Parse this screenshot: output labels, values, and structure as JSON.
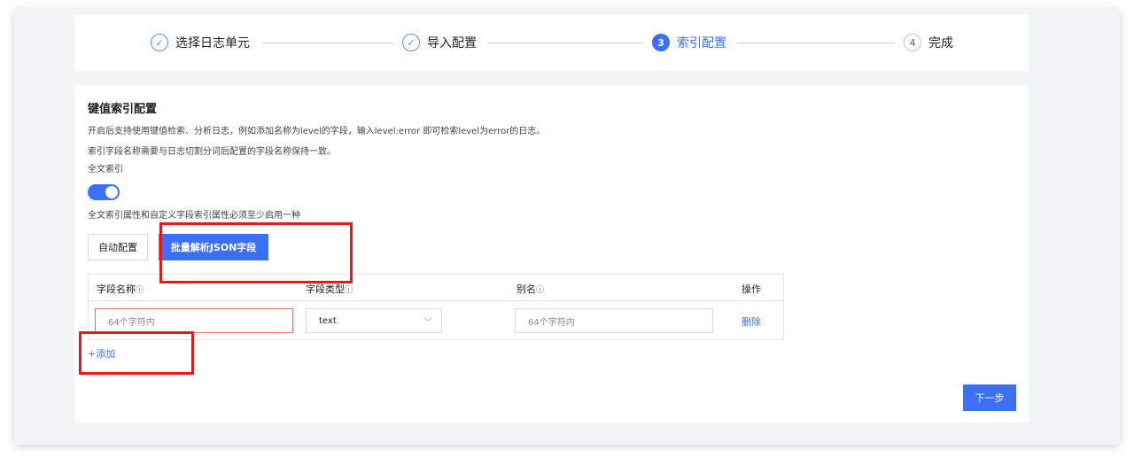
{
  "steps": [
    {
      "label": "选择日志单元",
      "marker": "✓",
      "state": "done"
    },
    {
      "label": "导入配置",
      "marker": "✓",
      "state": "done"
    },
    {
      "label": "索引配置",
      "marker": "3",
      "state": "active"
    },
    {
      "label": "完成",
      "marker": "4",
      "state": "pending"
    }
  ],
  "section": {
    "title": "键值索引配置",
    "desc1": "开启后支持使用键值检索、分析日志，例如添加名称为level的字段，输入level:error 即可检索level为error的日志。",
    "desc2": "索引字段名称需要与日志切割分词后配置的字段名称保持一致。",
    "fulltext_label": "全文索引",
    "fulltext_enabled": true,
    "fulltext_hint": "全文索引属性和自定义字段索引属性必须至少启用一种"
  },
  "buttons": {
    "auto_config": "自动配置",
    "batch_json": "批量解析JSON字段",
    "add": "+添加",
    "next": "下一步"
  },
  "table": {
    "headers": {
      "field_name": "字段名称",
      "field_type": "字段类型",
      "alias": "别名",
      "action": "操作"
    },
    "info_glyph": "ⓘ",
    "row": {
      "field_name_placeholder": "64个字符内",
      "field_type_value": "text",
      "alias_placeholder": "64个字符内",
      "action_label": "删除"
    }
  },
  "colors": {
    "accent": "#3b6ff5",
    "highlight": "#e41b1b",
    "error_border": "#f56c6c"
  }
}
